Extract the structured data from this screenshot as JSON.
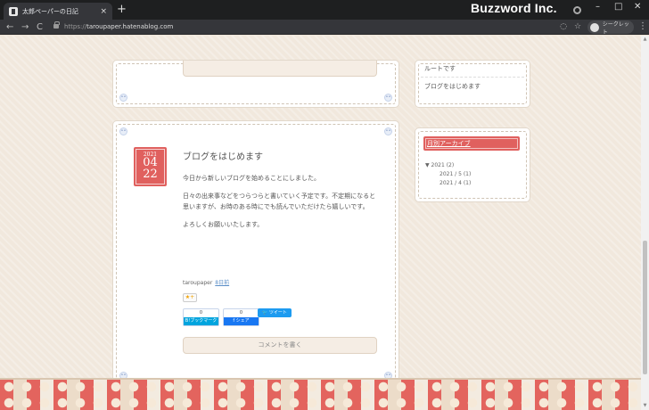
{
  "browser": {
    "tab_title": "太郎ペーパーの日記",
    "tab_close": "×",
    "new_tab": "+",
    "brand": "Buzzword Inc.",
    "url_prefix": "https://",
    "url_host": "taroupaper.hatenablog.com",
    "incognito_label": "シークレット",
    "nav": {
      "back": "←",
      "forward": "→",
      "reload": "C"
    },
    "window": {
      "minimize": "–",
      "maximize": "□",
      "close": "✕"
    },
    "menu": "⋮"
  },
  "sidebar": {
    "recent_entries": [
      "ルートです",
      "ブログをはじめます"
    ],
    "archive": {
      "heading": "月別アーカイブ",
      "year_label": "▼ 2021 (2)",
      "months": [
        "2021 / 5 (1)",
        "2021 / 4 (1)"
      ]
    }
  },
  "article": {
    "date": {
      "year": "2021",
      "month": "04",
      "day": "22"
    },
    "title": "ブログをはじめます",
    "paragraphs": [
      "今日から新しいブログを始めることにしました。",
      "日々の出来事などをつらつらと書いていく予定です。不定期になると思いますが、お時のある時にでも読んでいただけたら嬉しいです。",
      "よろしくお願いいたします。"
    ],
    "author": "taroupaper",
    "time_ago": "8日前",
    "star_label": "★+",
    "share": {
      "bookmark_count": "0",
      "bookmark_label": "B!ブックマーク",
      "facebook_count": "0",
      "facebook_label": "f シェア",
      "tweet_label": "ツイート"
    },
    "comment_button": "コメントを書く"
  },
  "colors": {
    "accent": "#e0605e",
    "page_bg": "#f1e8dd",
    "chrome": "#35363a"
  }
}
